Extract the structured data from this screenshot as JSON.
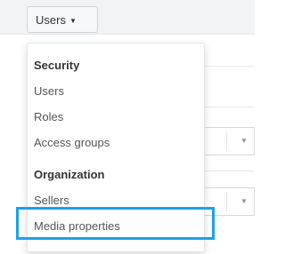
{
  "toolbar": {
    "users_button_label": "Users"
  },
  "menu": {
    "groups": [
      {
        "header": "Security",
        "items": [
          {
            "label": "Users"
          },
          {
            "label": "Roles"
          },
          {
            "label": "Access groups"
          }
        ]
      },
      {
        "header": "Organization",
        "items": [
          {
            "label": "Sellers"
          },
          {
            "label": "Media properties"
          }
        ]
      }
    ],
    "highlighted_item": "Media properties"
  },
  "colors": {
    "highlight_border": "#1aa3e8",
    "menu_text": "#555555",
    "header_text": "#333333"
  },
  "icons": {
    "dropdown_caret": "caret-down-icon",
    "select_caret": "caret-down-icon"
  }
}
